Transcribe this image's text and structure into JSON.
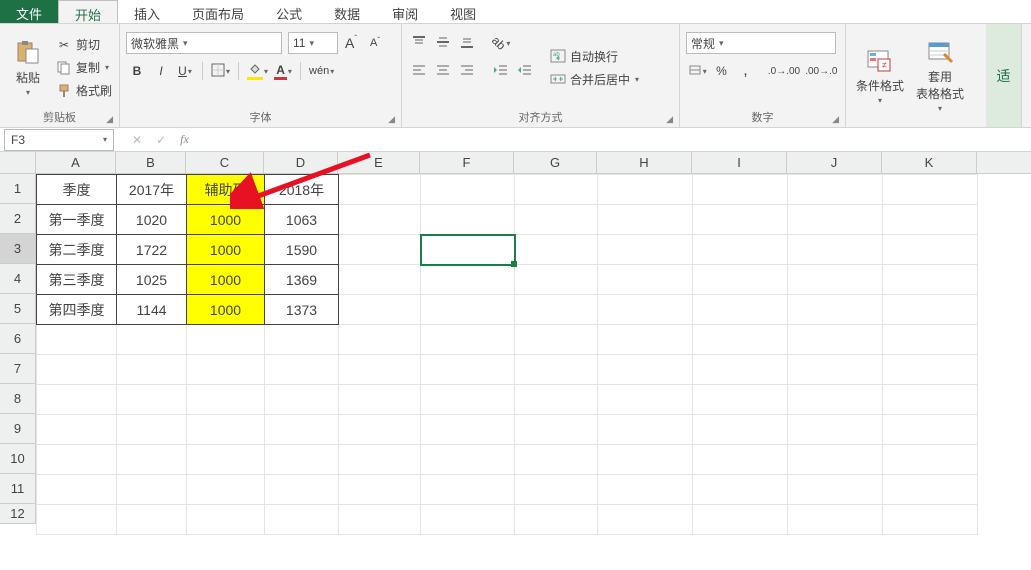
{
  "tabs": {
    "file": "文件",
    "items": [
      "开始",
      "插入",
      "页面布局",
      "公式",
      "数据",
      "审阅",
      "视图"
    ],
    "active": "开始"
  },
  "ribbon": {
    "clipboard": {
      "label": "剪贴板",
      "paste": "粘贴",
      "cut": "剪切",
      "copy": "复制",
      "format_painter": "格式刷"
    },
    "font": {
      "label": "字体",
      "font_name": "微软雅黑",
      "font_size": "11",
      "bold": "B",
      "italic": "I",
      "underline": "U",
      "wen": "wén"
    },
    "alignment": {
      "label": "对齐方式",
      "wrap": "自动换行",
      "merge": "合并后居中"
    },
    "number": {
      "label": "数字",
      "format": "常规"
    },
    "styles_cond": "条件格式",
    "styles_table": "套用\n表格格式",
    "fit": "适"
  },
  "formula_bar": {
    "name_box": "F3",
    "formula": ""
  },
  "sheet": {
    "columns": [
      "A",
      "B",
      "C",
      "D",
      "E",
      "F",
      "G",
      "H",
      "I",
      "J",
      "K"
    ],
    "rows": [
      1,
      2,
      3,
      4,
      5,
      6,
      7,
      8,
      9,
      10,
      11,
      12
    ],
    "selected_row_header": 3,
    "selected_cell": "F3",
    "data": {
      "headers": [
        "季度",
        "2017年",
        "辅助列",
        "2018年"
      ],
      "rows": [
        [
          "第一季度",
          "1020",
          "1000",
          "1063"
        ],
        [
          "第二季度",
          "1722",
          "1000",
          "1590"
        ],
        [
          "第三季度",
          "1025",
          "1000",
          "1369"
        ],
        [
          "第四季度",
          "1144",
          "1000",
          "1373"
        ]
      ],
      "highlight_column_index": 2
    }
  },
  "chart_data": {
    "type": "table",
    "title": "",
    "columns": [
      "季度",
      "2017年",
      "辅助列",
      "2018年"
    ],
    "rows": [
      [
        "第一季度",
        1020,
        1000,
        1063
      ],
      [
        "第二季度",
        1722,
        1000,
        1590
      ],
      [
        "第三季度",
        1025,
        1000,
        1369
      ],
      [
        "第四季度",
        1144,
        1000,
        1373
      ]
    ]
  }
}
